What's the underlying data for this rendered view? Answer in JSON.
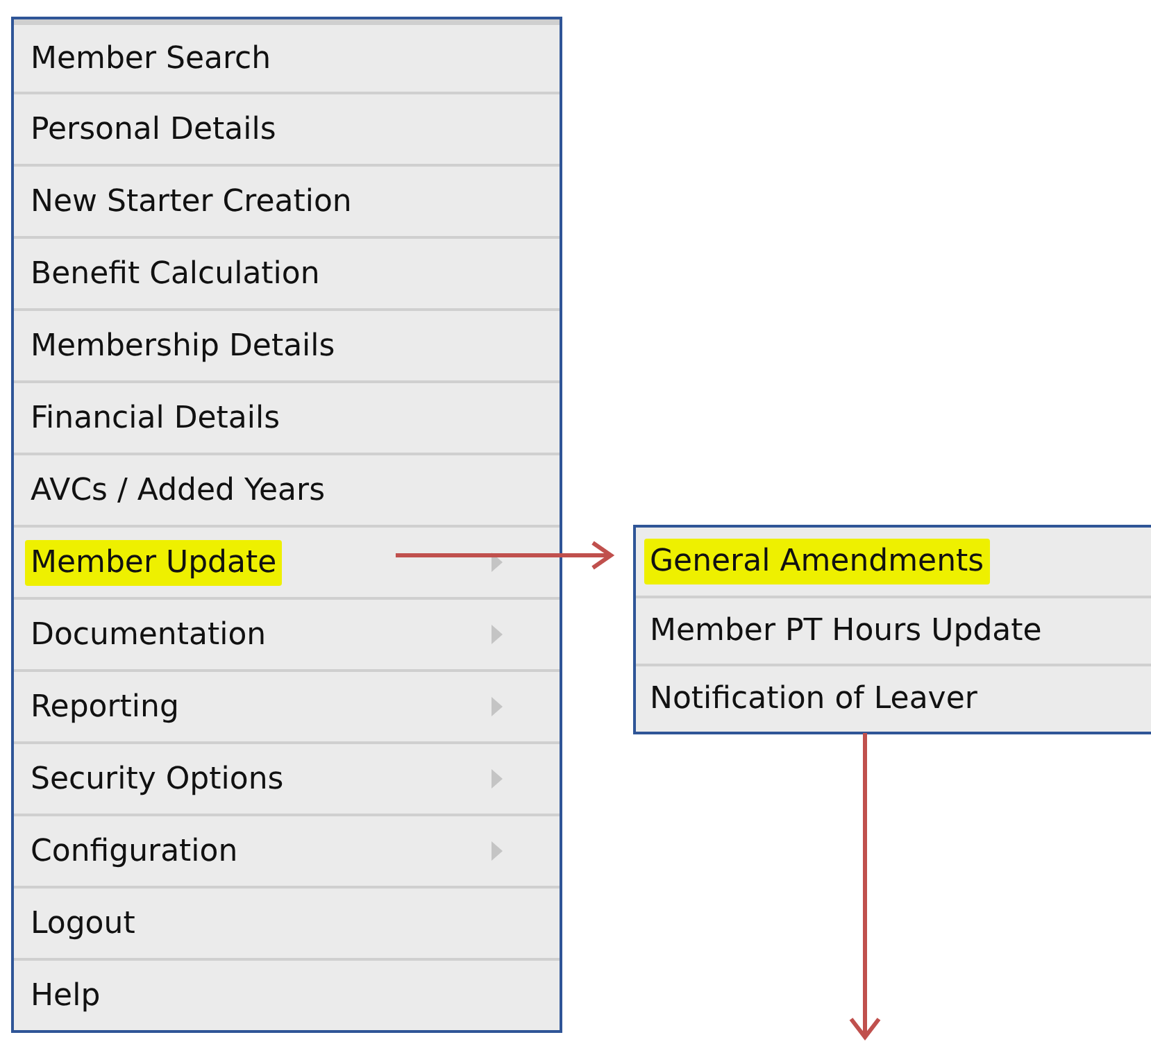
{
  "menu": {
    "items": [
      {
        "label": "Member Search",
        "highlighted": false,
        "has_submenu": false
      },
      {
        "label": "Personal Details",
        "highlighted": false,
        "has_submenu": false
      },
      {
        "label": "New Starter Creation",
        "highlighted": false,
        "has_submenu": false
      },
      {
        "label": "Benefit Calculation",
        "highlighted": false,
        "has_submenu": false
      },
      {
        "label": "Membership Details",
        "highlighted": false,
        "has_submenu": false
      },
      {
        "label": "Financial Details",
        "highlighted": false,
        "has_submenu": false
      },
      {
        "label": "AVCs / Added Years",
        "highlighted": false,
        "has_submenu": false
      },
      {
        "label": "Member Update",
        "highlighted": true,
        "has_submenu": true
      },
      {
        "label": "Documentation",
        "highlighted": false,
        "has_submenu": true
      },
      {
        "label": "Reporting",
        "highlighted": false,
        "has_submenu": true
      },
      {
        "label": "Security Options",
        "highlighted": false,
        "has_submenu": true
      },
      {
        "label": "Configuration",
        "highlighted": false,
        "has_submenu": true
      },
      {
        "label": "Logout",
        "highlighted": false,
        "has_submenu": false
      },
      {
        "label": "Help",
        "highlighted": false,
        "has_submenu": false
      }
    ]
  },
  "submenu": {
    "items": [
      {
        "label": "General Amendments",
        "highlighted": true
      },
      {
        "label": "Member PT Hours Update",
        "highlighted": false
      },
      {
        "label": "Notification of Leaver",
        "highlighted": false
      }
    ]
  }
}
